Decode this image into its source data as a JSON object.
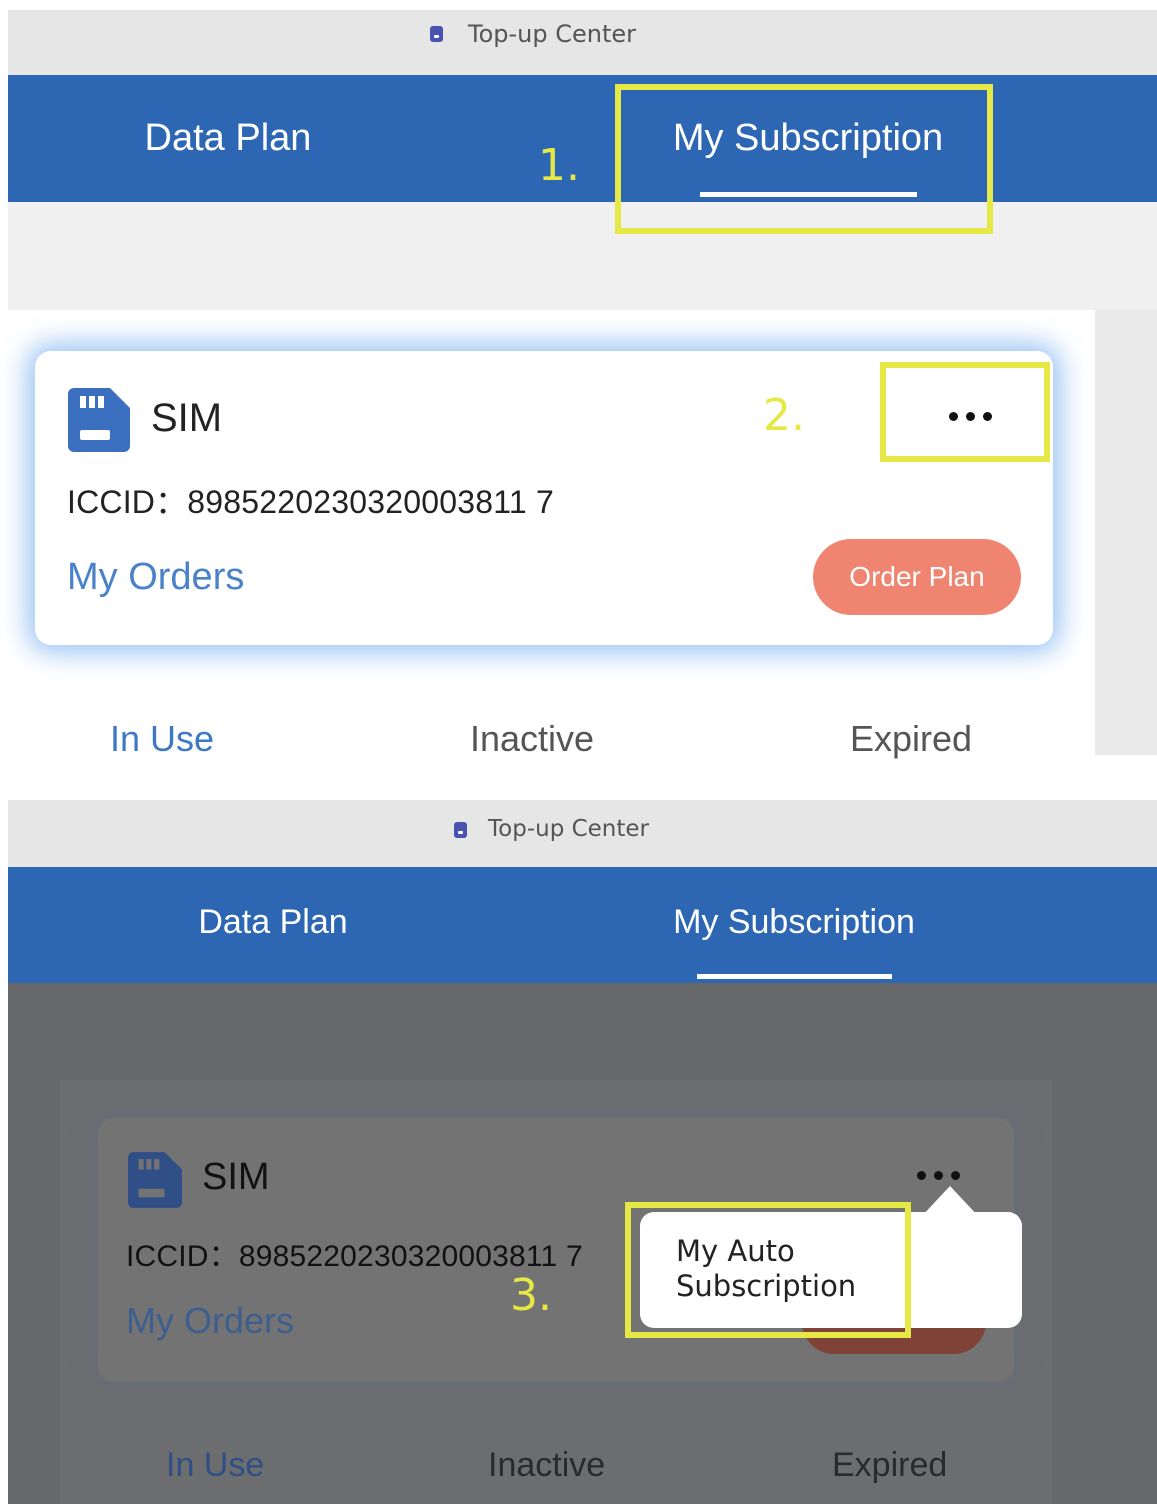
{
  "screens": [
    {
      "titlebar": {
        "icon": "app-icon",
        "title": "Top-up Center"
      },
      "tabs": [
        {
          "label": "Data Plan",
          "active": false
        },
        {
          "label": "My Subscription",
          "active": true
        }
      ],
      "card": {
        "icon": "sim-card-icon",
        "title": "SIM",
        "iccid": "ICCID：8985220230320003811 7",
        "my_orders": "My Orders",
        "order_plan": "Order Plan",
        "more_icon": "more-horizontal-icon"
      },
      "subtabs": [
        {
          "label": "In Use",
          "active": true
        },
        {
          "label": "Inactive",
          "active": false
        },
        {
          "label": "Expired",
          "active": false
        }
      ],
      "steps": [
        "1.",
        "2."
      ]
    },
    {
      "titlebar": {
        "icon": "app-icon",
        "title": "Top-up Center"
      },
      "tabs": [
        {
          "label": "Data Plan",
          "active": false
        },
        {
          "label": "My Subscription",
          "active": true
        }
      ],
      "card": {
        "icon": "sim-card-icon",
        "title": "SIM",
        "iccid": "ICCID：8985220230320003811 7",
        "my_orders": "My Orders",
        "more_icon": "more-horizontal-icon"
      },
      "popup": {
        "line1": "My Auto",
        "line2": "Subscription"
      },
      "subtabs": [
        {
          "label": "In Use",
          "active": true
        },
        {
          "label": "Inactive",
          "active": false
        },
        {
          "label": "Expired",
          "active": false
        }
      ],
      "steps": [
        "3."
      ],
      "colors": {
        "overlay": "#666769",
        "highlight": "#e6e845",
        "accent": "#2d67b3"
      }
    }
  ]
}
